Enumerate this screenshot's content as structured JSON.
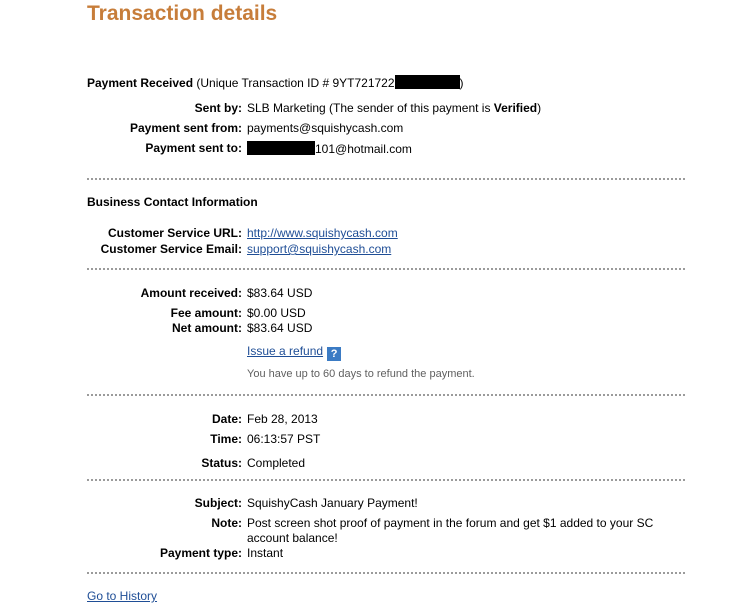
{
  "page": {
    "title": "Transaction details"
  },
  "payment": {
    "heading": "Payment Received",
    "txn_prefix": " (Unique Transaction ID # 9YT721722",
    "txn_suffix": ")",
    "sent_by_label": "Sent by:",
    "sent_by_value": "SLB Marketing (The sender of this payment is ",
    "sent_by_verified": "Verified",
    "sent_by_close": ")",
    "sent_from_label": "Payment sent from:",
    "sent_from_value": "payments@squishycash.com",
    "sent_to_label": "Payment sent to:",
    "sent_to_suffix": "101@hotmail.com"
  },
  "business": {
    "heading": "Business Contact Information",
    "url_label": "Customer Service URL:",
    "url_value": "http://www.squishycash.com",
    "email_label": "Customer Service Email:",
    "email_value": "support@squishycash.com"
  },
  "amounts": {
    "received_label": "Amount received:",
    "received_value": "$83.64 USD",
    "fee_label": "Fee amount:",
    "fee_value": "$0.00 USD",
    "net_label": "Net amount:",
    "net_value": "$83.64 USD",
    "refund_link": "Issue a refund",
    "help_glyph": "?",
    "refund_note": "You have up to 60 days to refund the payment."
  },
  "details": {
    "date_label": "Date:",
    "date_value": "Feb 28, 2013",
    "time_label": "Time:",
    "time_value": "06:13:57 PST",
    "status_label": "Status:",
    "status_value": "Completed"
  },
  "message": {
    "subject_label": "Subject:",
    "subject_value": "SquishyCash January Payment!",
    "note_label": "Note:",
    "note_value": "Post screen shot proof of payment in the forum and get $1 added to your SC account balance!",
    "type_label": "Payment type:",
    "type_value": "Instant"
  },
  "footer": {
    "history_link": "Go to History"
  },
  "colors": {
    "title": "#c77d3a",
    "link": "#1f4e96",
    "help_icon": "#3b7bc4"
  }
}
